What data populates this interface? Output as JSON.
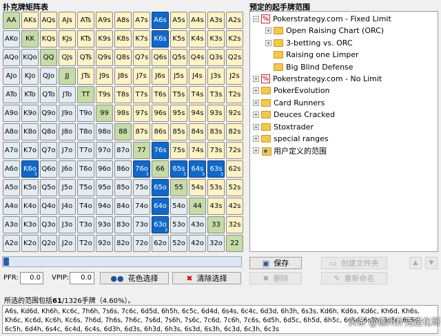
{
  "matrix": {
    "title": "扑克牌矩阵表",
    "rows": [
      [
        "AA",
        "AKs",
        "AQs",
        "AJs",
        "ATs",
        "A9s",
        "A8s",
        "A7s",
        "A6s",
        "A5s",
        "A4s",
        "A3s",
        "A2s"
      ],
      [
        "AKo",
        "KK",
        "KQs",
        "KJs",
        "KTs",
        "K9s",
        "K8s",
        "K7s",
        "K6s",
        "K5s",
        "K4s",
        "K3s",
        "K2s"
      ],
      [
        "AQo",
        "KQo",
        "QQ",
        "QJs",
        "QTs",
        "Q9s",
        "Q8s",
        "Q7s",
        "Q6s",
        "Q5s",
        "Q4s",
        "Q3s",
        "Q2s"
      ],
      [
        "AJo",
        "KJo",
        "QJo",
        "JJ",
        "JTs",
        "J9s",
        "J8s",
        "J7s",
        "J6s",
        "J5s",
        "J4s",
        "J3s",
        "J2s"
      ],
      [
        "ATo",
        "KTo",
        "QTo",
        "JTo",
        "TT",
        "T9s",
        "T8s",
        "T7s",
        "T6s",
        "T5s",
        "T4s",
        "T3s",
        "T2s"
      ],
      [
        "A9o",
        "K9o",
        "Q9o",
        "J9o",
        "T9o",
        "99",
        "98s",
        "97s",
        "96s",
        "95s",
        "94s",
        "93s",
        "92s"
      ],
      [
        "A8o",
        "K8o",
        "Q8o",
        "J8o",
        "T8o",
        "98o",
        "88",
        "87s",
        "86s",
        "85s",
        "84s",
        "83s",
        "82s"
      ],
      [
        "A7o",
        "K7o",
        "Q7o",
        "J7o",
        "T7o",
        "97o",
        "87o",
        "77",
        "76s",
        "75s",
        "74s",
        "73s",
        "72s"
      ],
      [
        "A6o",
        "K6o",
        "Q6o",
        "J6o",
        "T6o",
        "96o",
        "86o",
        "76o",
        "66",
        "65s",
        "64s",
        "63s",
        "62s"
      ],
      [
        "A5o",
        "K5o",
        "Q5o",
        "J5o",
        "T5o",
        "95o",
        "85o",
        "75o",
        "65o",
        "55",
        "54s",
        "53s",
        "52s"
      ],
      [
        "A4o",
        "K4o",
        "Q4o",
        "J4o",
        "T4o",
        "94o",
        "84o",
        "74o",
        "64o",
        "54o",
        "44",
        "43s",
        "42s"
      ],
      [
        "A3o",
        "K3o",
        "Q3o",
        "J3o",
        "T3o",
        "93o",
        "83o",
        "73o",
        "63o",
        "53o",
        "43o",
        "33",
        "32s"
      ],
      [
        "A2o",
        "K2o",
        "Q2o",
        "J2o",
        "T2o",
        "92o",
        "82o",
        "72o",
        "62o",
        "52o",
        "42o",
        "32o",
        "22"
      ]
    ],
    "selected": [
      [
        0,
        8
      ],
      [
        1,
        8
      ],
      [
        7,
        8
      ],
      [
        8,
        1
      ],
      [
        8,
        7
      ],
      [
        8,
        9
      ],
      [
        8,
        10
      ],
      [
        8,
        11
      ],
      [
        9,
        8
      ],
      [
        10,
        8
      ],
      [
        11,
        8
      ]
    ],
    "selected_sub": {
      "8-1": "5",
      "8-7": "5",
      "8-9": "3",
      "8-10": "3",
      "8-11": "3",
      "11-8": "3"
    },
    "colors": {
      "suited": "#fdf3c6",
      "offsuit": "#e3ecf3",
      "pair": "#c6dca8",
      "selected": "#1268c9"
    }
  },
  "tree": {
    "title": "预定的起手牌范围",
    "items": [
      {
        "label": "Pokerstrategy.com - Fixed Limit",
        "icon": "percent-icon",
        "expander": "−",
        "level": 0
      },
      {
        "label": "Open Raising Chart (ORC)",
        "icon": "folder-icon",
        "expander": "+",
        "level": 1
      },
      {
        "label": "3-betting vs. ORC",
        "icon": "folder-icon",
        "expander": "+",
        "level": 1
      },
      {
        "label": "Raising one Limper",
        "icon": "folder-icon",
        "expander": "",
        "level": 1
      },
      {
        "label": "Big Blind Defense",
        "icon": "folder-icon",
        "expander": "",
        "level": 1
      },
      {
        "label": "Pokerstrategy.com - No Limit",
        "icon": "percent-icon",
        "expander": "+",
        "level": 0
      },
      {
        "label": "PokerEvolution",
        "icon": "folder-icon",
        "expander": "+",
        "level": 0
      },
      {
        "label": "Card Runners",
        "icon": "folder-icon",
        "expander": "+",
        "level": 0
      },
      {
        "label": "Deuces Cracked",
        "icon": "folder-icon",
        "expander": "+",
        "level": 0
      },
      {
        "label": "Stoxtrader",
        "icon": "folder-icon",
        "expander": "+",
        "level": 0
      },
      {
        "label": "special ranges",
        "icon": "folder-icon",
        "expander": "+",
        "level": 0
      },
      {
        "label": "用户定义的范围",
        "icon": "users-folder-icon",
        "expander": "+",
        "level": 0
      }
    ]
  },
  "stats": {
    "pfr_label": "PFR:",
    "pfr_value": "0.0",
    "vpip_label": "VPIP:",
    "vpip_value": "0.0"
  },
  "buttons": {
    "suit_select": "花色选择",
    "clear_select": "清除选择",
    "save": "保存",
    "delete": "删除",
    "new_folder": "创建文件夹",
    "rename": "重新命名",
    "up_arrow": "▲",
    "down_arrow": "▼"
  },
  "status": {
    "prefix": "所选的范围包括",
    "count": "61",
    "suffix": "/1326手牌（4.60%）。"
  },
  "hands_text": "A6s, Kd6d, Kh6h, Kc6c, 7h6h, 7s6s, 7c6c, 6d5d, 6h5h, 6c5c, 6d4d, 6s4s, 6c4c, 6d3d, 6h3h, 6s3s, Kd6h, Kd6s, Kd6c, Kh6d, Kh6s, Kh6c, Kc6d, Kc6h, Kc6s, 7h6d, 7h6s, 7h6c, 7s6d, 7s6h, 7s6c, 7c6d, 7c6h, 7c6s, 6d5h, 6d5c, 6h5d, 6h5c, 6s5d, 6s5h, 6s5c, 6c5d, 6c5h, 6d4h, 6s4c, 6c4d, 6c4s, 6d3h, 6d3s, 6h3d, 6h3s, 6s3d, 6s3h, 6c3d, 6c3h, 6c3s",
  "watermark": "头条 @德州扑克进化哥"
}
